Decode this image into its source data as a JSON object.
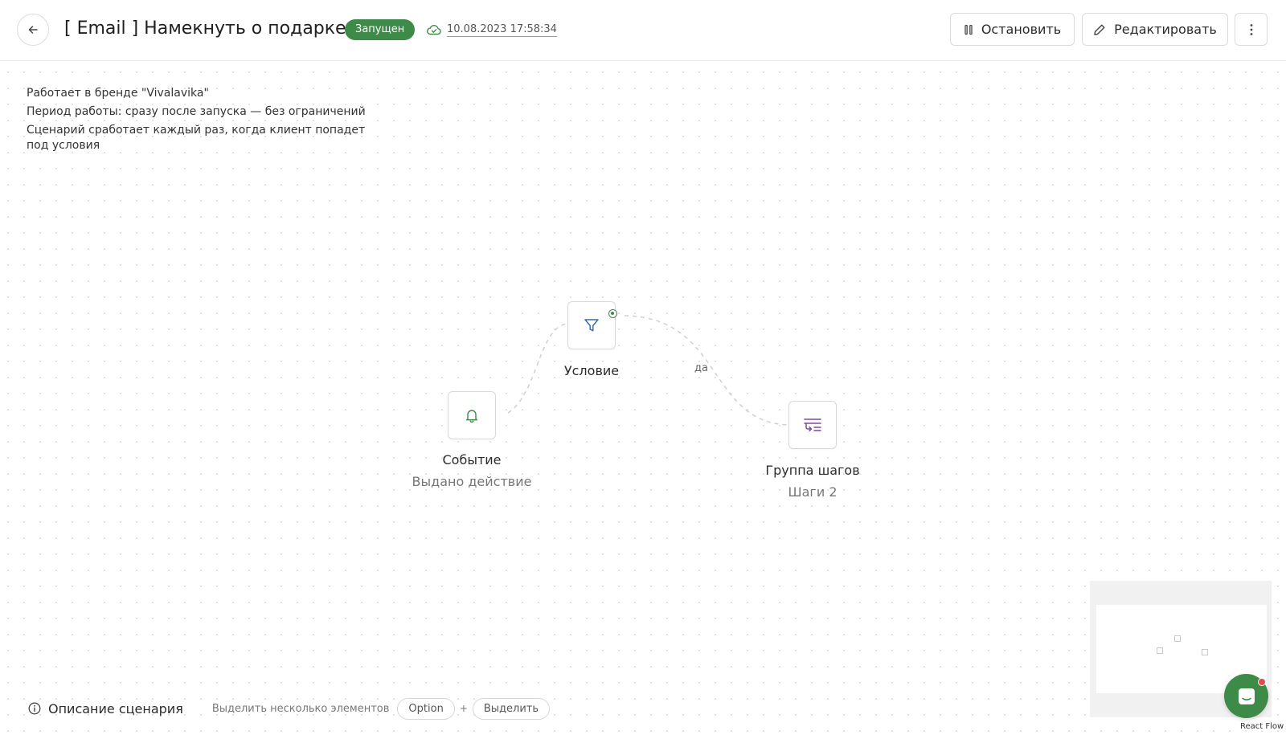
{
  "header": {
    "title": "[ Email ] Намекнуть о подарке",
    "status_badge": "Запущен",
    "saved_at": "10.08.2023 17:58:34",
    "stop_label": "Остановить",
    "edit_label": "Редактировать",
    "icons": {
      "back": "arrow-left-icon",
      "cloud": "cloud-icon",
      "pause": "pause-icon",
      "pencil": "pencil-icon",
      "more": "kebab-icon"
    }
  },
  "info": {
    "brand": "Работает в бренде \"Vivalavika\"",
    "period": "Период работы: сразу после запуска — без ограничений",
    "trigger": "Сценарий сработает каждый раз, когда клиент попадет под условия"
  },
  "flow": {
    "nodes": {
      "event": {
        "title": "Событие",
        "subtitle": "Выдано действие",
        "icon": "bell-icon"
      },
      "condition": {
        "title": "Условие",
        "icon": "funnel-icon"
      },
      "group": {
        "title": "Группа шагов",
        "subtitle": "Шаги 2",
        "icon": "step-group-icon"
      }
    },
    "edge_label": "да"
  },
  "footer": {
    "description_label": "Описание сценария",
    "hint": "Выделить несколько элементов",
    "key_option": "Option",
    "plus": "+",
    "key_select": "Выделить"
  },
  "attribution": "React Flow",
  "colors": {
    "accent": "#3d8a49",
    "group_icon": "#7b4a9e",
    "notification_dot": "#e5484d"
  }
}
